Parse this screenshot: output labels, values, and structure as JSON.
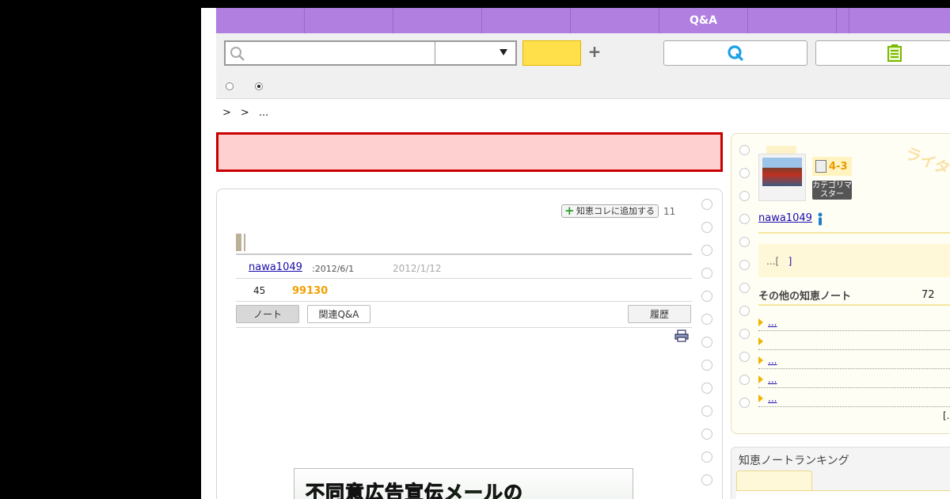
{
  "nav": {
    "items": [
      "",
      "",
      "",
      "",
      "",
      "Q&A",
      "",
      "",
      ""
    ]
  },
  "search": {
    "placeholder": "",
    "select_value": "",
    "button_label": ""
  },
  "breadcrumb": {
    "items": [
      ">",
      ">",
      "..."
    ]
  },
  "alert": {
    "link_text": ""
  },
  "note": {
    "chiecolle_label": "知恵コレに追加する",
    "chiecolle_count": "11",
    "author": "nawa1049",
    "date_label": ":2012/6/1",
    "updated": "2012/1/12",
    "views": "45",
    "points": "99130",
    "tabs": {
      "note": "ノート",
      "related": "関連Q&A",
      "history": "履歴"
    },
    "banner_text": "不同意広告宣伝メールの"
  },
  "side": {
    "stamp_text": "ライター",
    "grade": "4-3",
    "master_badge": "カテゴリマスター",
    "author": "nawa1049",
    "quote_prefix": "...[",
    "quote_suffix": "]",
    "other_notes_title": "その他の知恵ノート",
    "other_notes_count": "72",
    "links": [
      "...",
      "",
      "...",
      "...",
      "..."
    ],
    "more": "[..."
  },
  "ranking": {
    "title": "知恵ノートランキング"
  },
  "colors": {
    "nav_bg": "#b07fe0",
    "search_button": "#ffe04a",
    "alert_bg": "#ffd0d0",
    "alert_border": "#c80000",
    "points": "#f0a000",
    "link": "#1a0dab"
  },
  "icons": {
    "search": "search-icon",
    "plus": "plus-icon",
    "ask": "q-icon",
    "note": "note-icon",
    "print": "print-icon"
  }
}
